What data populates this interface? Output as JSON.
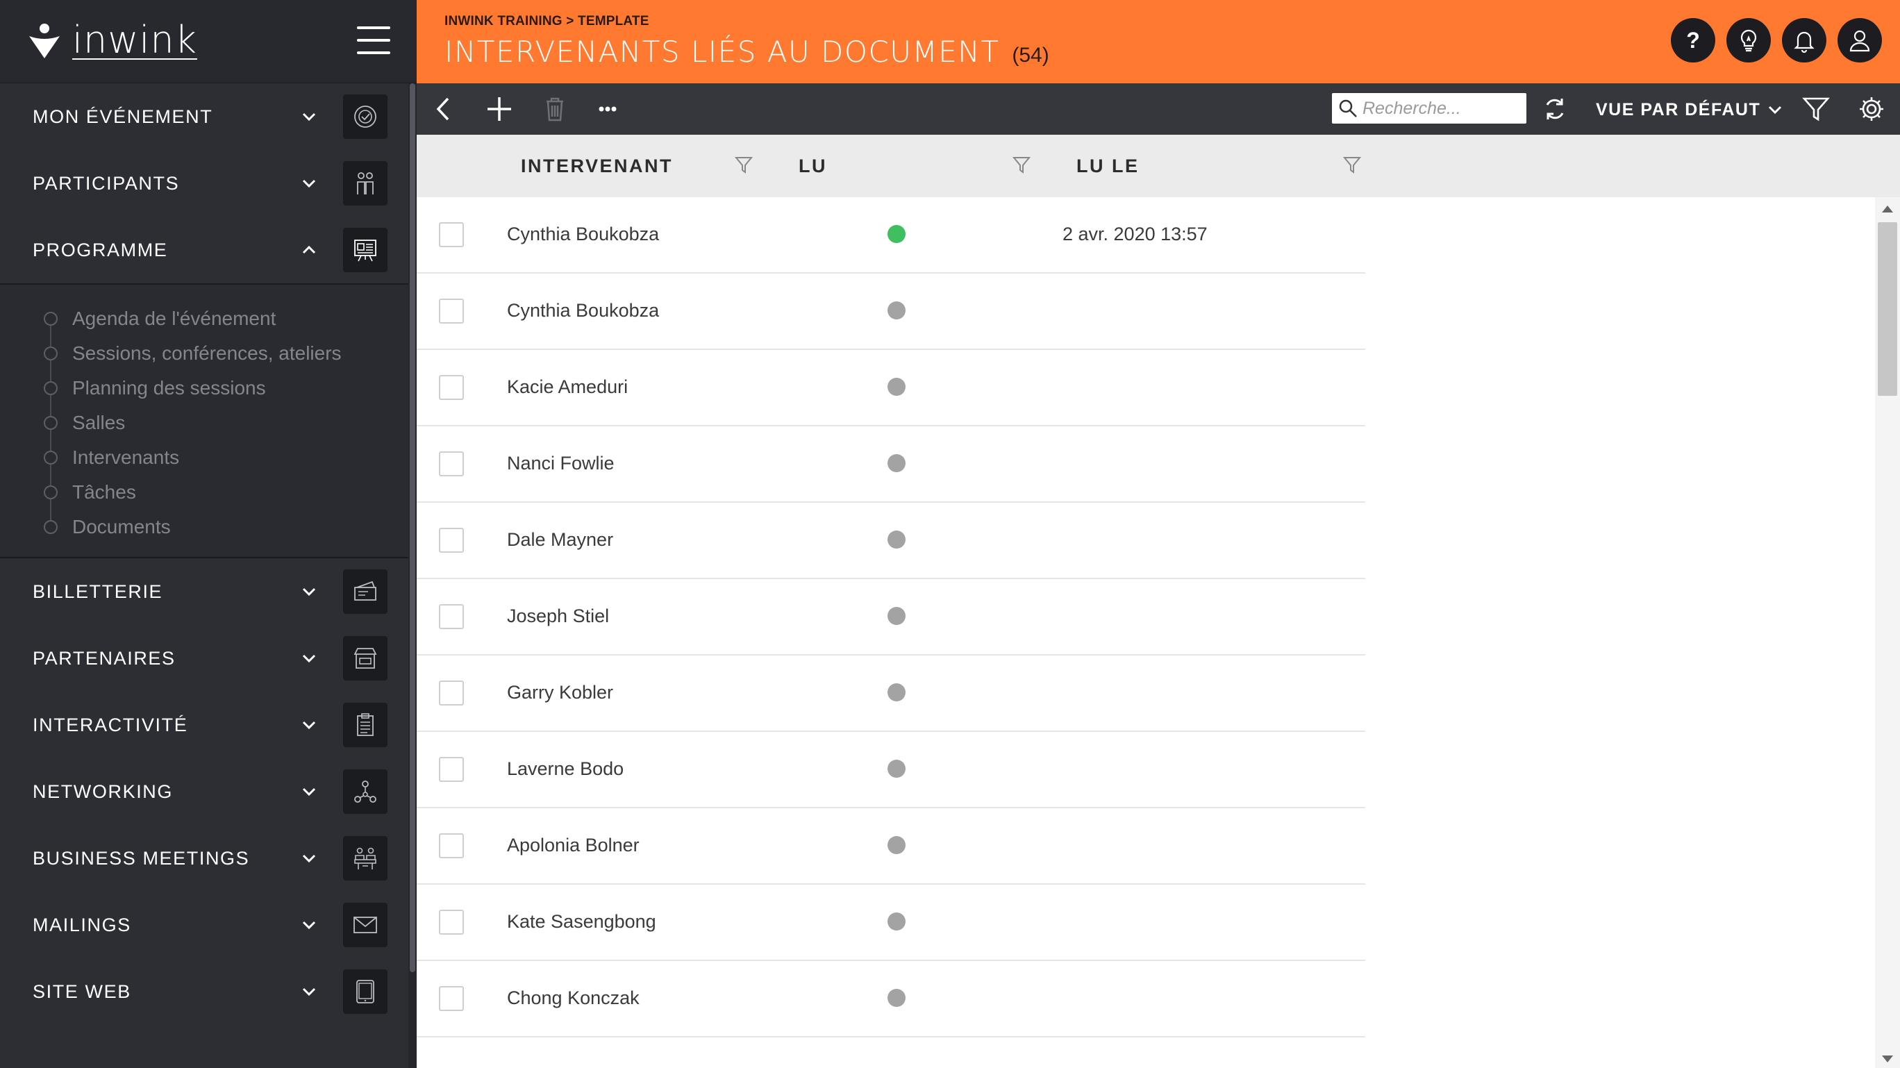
{
  "brand": {
    "name": "inwink"
  },
  "header": {
    "breadcrumb": "INWINK TRAINING > TEMPLATE",
    "title": "INTERVENANTS LIÉS AU DOCUMENT",
    "count": "(54)"
  },
  "sidebar": {
    "items": [
      {
        "label": "MON ÉVÉNEMENT",
        "icon": "badge-check-icon",
        "expanded": false
      },
      {
        "label": "PARTICIPANTS",
        "icon": "people-icon",
        "expanded": false
      },
      {
        "label": "PROGRAMME",
        "icon": "presentation-board-icon",
        "expanded": true
      },
      {
        "label": "BILLETTERIE",
        "icon": "tickets-icon",
        "expanded": false
      },
      {
        "label": "PARTENAIRES",
        "icon": "storefront-icon",
        "expanded": false
      },
      {
        "label": "INTERACTIVITÉ",
        "icon": "clipboard-icon",
        "expanded": false
      },
      {
        "label": "NETWORKING",
        "icon": "network-icon",
        "expanded": false
      },
      {
        "label": "BUSINESS MEETINGS",
        "icon": "meeting-icon",
        "expanded": false
      },
      {
        "label": "MAILINGS",
        "icon": "envelope-icon",
        "expanded": false
      },
      {
        "label": "SITE WEB",
        "icon": "tablet-icon",
        "expanded": false
      }
    ],
    "programme_subitems": [
      "Agenda de l'événement",
      "Sessions, conférences, ateliers",
      "Planning des sessions",
      "Salles",
      "Intervenants",
      "Tâches",
      "Documents"
    ]
  },
  "toolbar": {
    "search_placeholder": "Recherche...",
    "view_label": "VUE PAR DÉFAUT"
  },
  "table": {
    "columns": [
      "INTERVENANT",
      "LU",
      "LU LE"
    ],
    "rows": [
      {
        "name": "Cynthia Boukobza",
        "read": true,
        "read_at": "2 avr. 2020 13:57"
      },
      {
        "name": "Cynthia Boukobza",
        "read": false,
        "read_at": ""
      },
      {
        "name": "Kacie Ameduri",
        "read": false,
        "read_at": ""
      },
      {
        "name": "Nanci Fowlie",
        "read": false,
        "read_at": ""
      },
      {
        "name": "Dale Mayner",
        "read": false,
        "read_at": ""
      },
      {
        "name": "Joseph Stiel",
        "read": false,
        "read_at": ""
      },
      {
        "name": "Garry Kobler",
        "read": false,
        "read_at": ""
      },
      {
        "name": "Laverne Bodo",
        "read": false,
        "read_at": ""
      },
      {
        "name": "Apolonia Bolner",
        "read": false,
        "read_at": ""
      },
      {
        "name": "Kate Sasengbong",
        "read": false,
        "read_at": ""
      },
      {
        "name": "Chong Konczak",
        "read": false,
        "read_at": ""
      }
    ]
  },
  "colors": {
    "accent": "#ff7a30",
    "sidebar_bg": "#2d2e34",
    "toolbar_bg": "#36373d",
    "read_dot": "#3fbf5f",
    "unread_dot": "#a3a3a3"
  }
}
